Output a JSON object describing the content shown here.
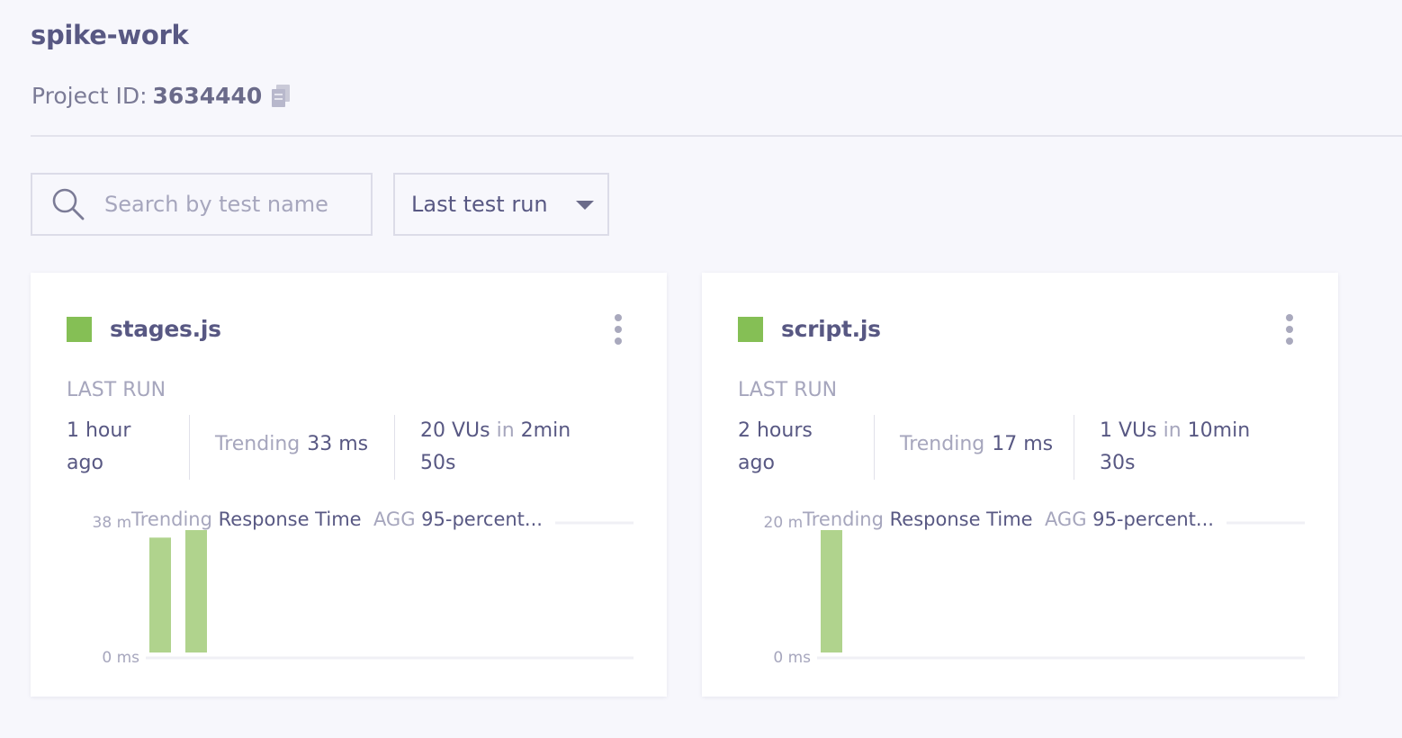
{
  "header": {
    "project_name": "spike-work",
    "project_id_label": "Project ID:",
    "project_id": "3634440"
  },
  "filters": {
    "search_placeholder": "Search by test name",
    "sort_selected": "Last test run"
  },
  "colors": {
    "status_ok": "#85bf55",
    "bar": "#b0d38d",
    "text_primary": "#585883",
    "text_muted": "#a6a6bd"
  },
  "cards": [
    {
      "name": "stages.js",
      "last_run_label": "LAST RUN",
      "time_line1": "1 hour",
      "time_line2": "ago",
      "trending_label": "Trending",
      "trending_value": "33 ms",
      "vus_count": "20 VUs",
      "vus_in": "in",
      "vus_duration_1": "2min",
      "vus_duration_2": "50s",
      "chart_legend": {
        "trending": "Trending",
        "metric": "Response Time",
        "agg_label": "AGG",
        "agg_value": "95-percent..."
      },
      "chart_data": {
        "type": "bar",
        "ylim": [
          0,
          38
        ],
        "y_tick_labels": [
          "38 ms",
          "0 ms"
        ],
        "values": [
          33,
          38
        ]
      }
    },
    {
      "name": "script.js",
      "last_run_label": "LAST RUN",
      "time_line1": "2 hours",
      "time_line2": "ago",
      "trending_label": "Trending",
      "trending_value": "17 ms",
      "vus_count": "1 VUs",
      "vus_in": "in",
      "vus_duration_1": "10min",
      "vus_duration_2": "30s",
      "chart_legend": {
        "trending": "Trending",
        "metric": "Response Time",
        "agg_label": "AGG",
        "agg_value": "95-percent..."
      },
      "chart_data": {
        "type": "bar",
        "ylim": [
          0,
          20
        ],
        "y_tick_labels": [
          "20 ms",
          "0 ms"
        ],
        "values": [
          20
        ]
      }
    }
  ]
}
